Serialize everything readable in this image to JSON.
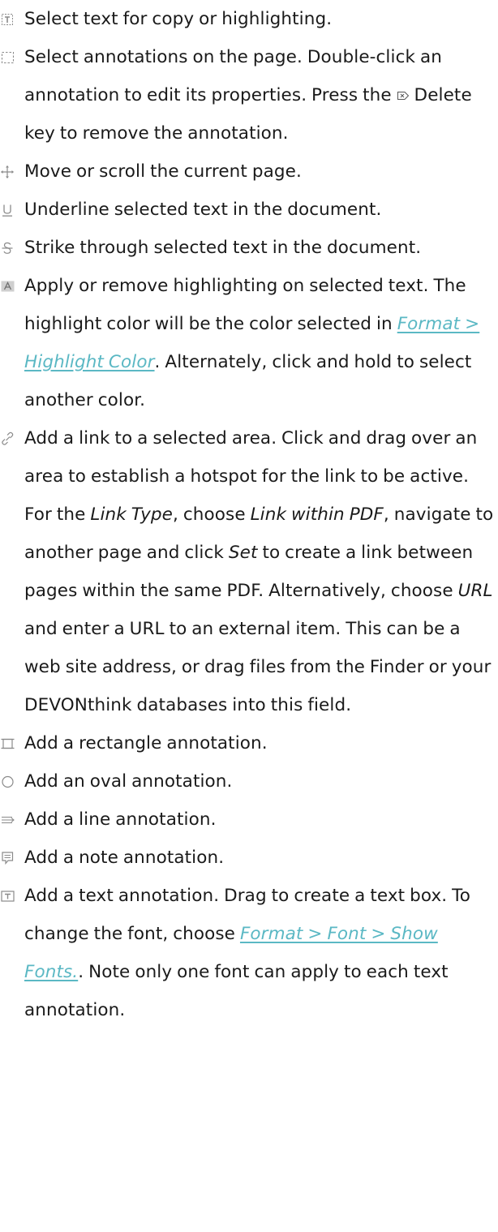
{
  "items": [
    {
      "icon": "text-select-icon",
      "text": "Select text for copy or highlighting."
    },
    {
      "icon": "annotation-select-icon",
      "text_a": "Select annotations on the page. Double-click an annotation to edit its properties. Press the ",
      "key_icon": "delete-key-icon",
      "text_b": " Delete key to remove the annotation."
    },
    {
      "icon": "move-icon",
      "text": "Move or scroll the current page."
    },
    {
      "icon": "underline-icon",
      "text": "Underline selected text in the document."
    },
    {
      "icon": "strikethrough-icon",
      "text": "Strike through selected text in the document."
    },
    {
      "icon": "highlight-icon",
      "text_a": "Apply or remove highlighting on selected text. The highlight color will be the color selected in ",
      "link": "Format > Highlight Color",
      "text_b": ". Alternately, click and hold to select another color."
    },
    {
      "icon": "link-icon",
      "t1": "Add a link to a selected area. Click and drag over an area to establish a hotspot for the link to be active. For the ",
      "e1": "Link Type",
      "t2": ", choose ",
      "e2": "Link within PDF",
      "t3": ", navigate to another page and click ",
      "e3": "Set",
      "t4": " to create a link between pages within the same PDF. Alternatively, choose ",
      "e4": "URL",
      "t5": " and enter a URL to an external item. This can be a web site address, or drag files from the Finder or your DEVONthink databases into this field."
    },
    {
      "icon": "rectangle-icon",
      "text": "Add a rectangle annotation."
    },
    {
      "icon": "oval-icon",
      "text": "Add an oval annotation."
    },
    {
      "icon": "line-icon",
      "text": "Add a line annotation."
    },
    {
      "icon": "note-icon",
      "text": "Add a note annotation."
    },
    {
      "icon": "text-box-icon",
      "text_a": "Add a text annotation. Drag to create a text box. To change the font, choose ",
      "link": "Format > Font > Show Fonts.",
      "text_b": ". Note only one font can apply to each text annotation."
    }
  ],
  "colors": {
    "text": "#1a1a1a",
    "link": "#5bb8c4",
    "icon": "#8a8a8a"
  }
}
